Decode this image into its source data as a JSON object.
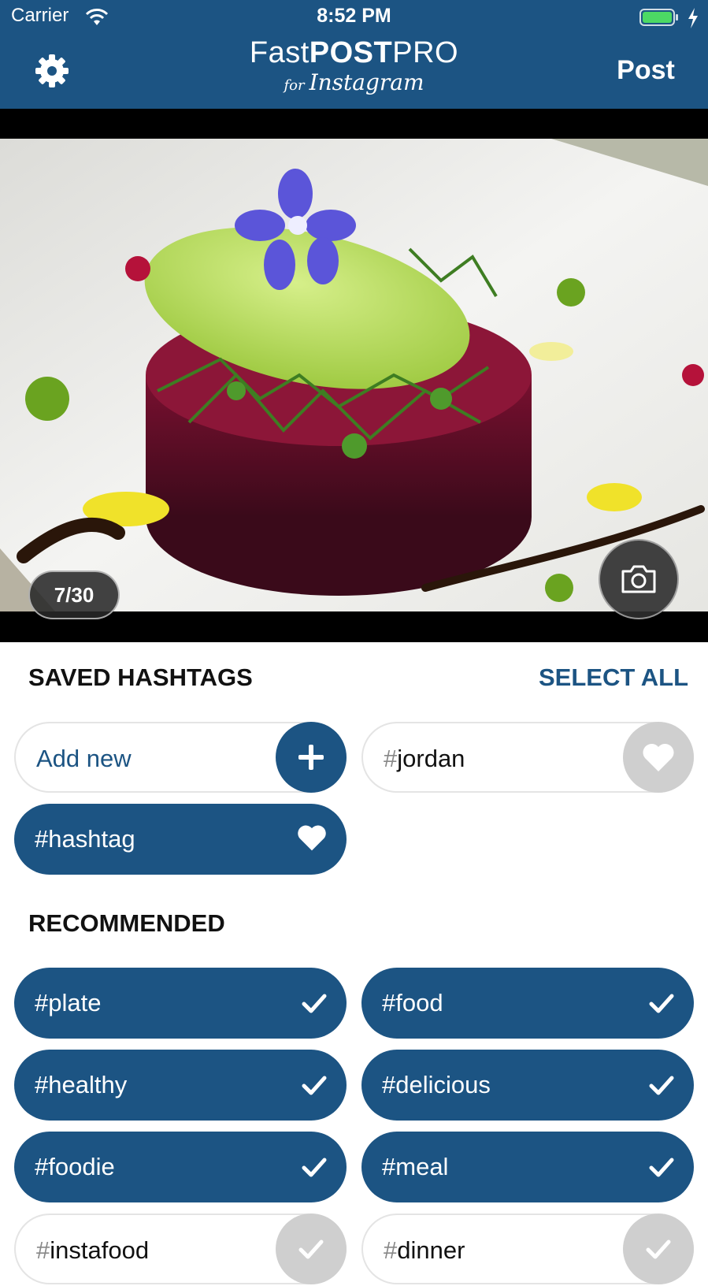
{
  "status_bar": {
    "carrier": "Carrier",
    "time": "8:52 PM"
  },
  "header": {
    "logo_fast": "Fast",
    "logo_post": "POST",
    "logo_pro": "PRO",
    "logo_for": "for",
    "logo_instagram": "Instagram",
    "post_label": "Post"
  },
  "photo": {
    "counter": "7/30"
  },
  "saved": {
    "title": "SAVED HASHTAGS",
    "select_all": "SELECT ALL",
    "add_new": "Add new",
    "items": [
      {
        "hash": "#",
        "tag": "jordan"
      },
      {
        "hash": "#",
        "tag": "hashtag"
      }
    ]
  },
  "recommended": {
    "title": "RECOMMENDED",
    "items": [
      {
        "hash": "#",
        "tag": "plate"
      },
      {
        "hash": "#",
        "tag": "food"
      },
      {
        "hash": "#",
        "tag": "healthy"
      },
      {
        "hash": "#",
        "tag": "delicious"
      },
      {
        "hash": "#",
        "tag": "foodie"
      },
      {
        "hash": "#",
        "tag": "meal"
      },
      {
        "hash": "#",
        "tag": "instafood"
      },
      {
        "hash": "#",
        "tag": "dinner"
      }
    ]
  },
  "colors": {
    "accent": "#1c5483",
    "grey_button": "#cfcfcf"
  }
}
